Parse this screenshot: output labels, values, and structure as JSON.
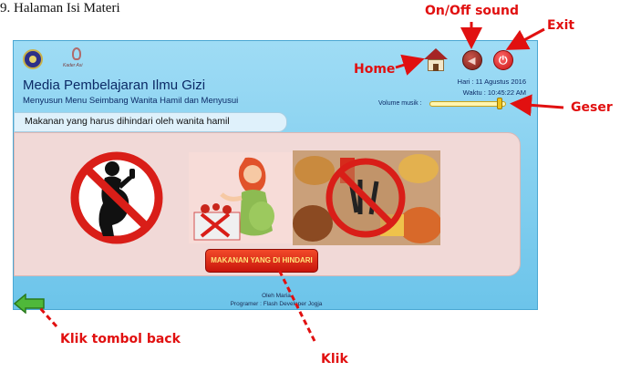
{
  "document": {
    "caption": "9. Halaman Isi Materi"
  },
  "callouts": {
    "home": "Home",
    "sound": "On/Off sound",
    "exit": "Exit",
    "slider": "Geser",
    "back": "Klik tombol back",
    "click": "Klik"
  },
  "app": {
    "logo_text": "Kader Asi",
    "title": "Media Pembelajaran Ilmu Gizi",
    "subtitle": "Menyusun Menu Seimbang Wanita Hamil dan  Menyusui",
    "date": "Hari : 11 Agustus 2016",
    "time": "Waktu : 10:45:22 AM",
    "volume_label": "Volume musik :",
    "volume_level": 0.95,
    "heading": "Makanan yang harus dihindari oleh wanita hamil",
    "action_button": "MAKANAN YANG DI HINDARI",
    "credits_line1": "Oleh Maria",
    "credits_line2": "Programer : Flash Developer Jogja"
  },
  "icons": {
    "home": "home-icon",
    "sound": "speaker-icon",
    "exit": "power-icon",
    "back": "back-arrow-icon"
  },
  "colors": {
    "callout": "#e11010",
    "app_bg": "#8fd4f3",
    "panel_bg": "#f1d9d7",
    "button": "#d9200f",
    "button_text": "#ffe37a",
    "prohibition": "#d91e18"
  }
}
